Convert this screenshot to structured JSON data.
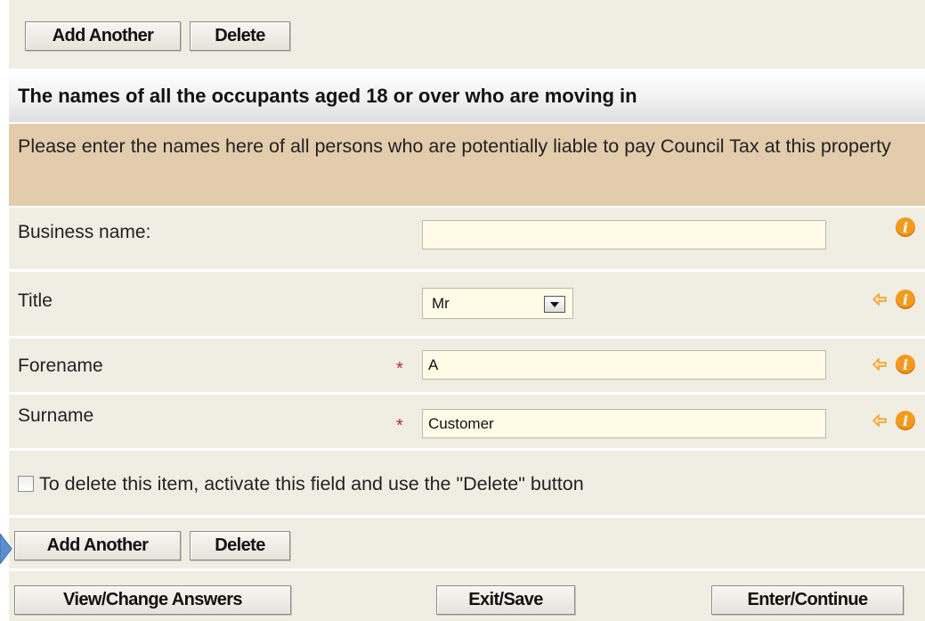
{
  "top_actions": {
    "add_another": "Add Another",
    "delete": "Delete"
  },
  "section": {
    "title": "The names of all the occupants aged 18 or over who are moving in",
    "instructions": "Please enter the names here of all persons who are potentially liable to pay Council Tax at this property"
  },
  "fields": {
    "business_name": {
      "label": "Business name:",
      "value": ""
    },
    "title": {
      "label": "Title",
      "value": "Mr"
    },
    "forename": {
      "label": "Forename",
      "value": "A",
      "required_mark": "*"
    },
    "surname": {
      "label": "Surname",
      "value": "Customer",
      "required_mark": "*"
    }
  },
  "delete_checkbox": {
    "label": "To delete this item, activate this field and use the \"Delete\" button",
    "checked": false
  },
  "bottom_actions": {
    "add_another": "Add Another",
    "delete": "Delete"
  },
  "footer": {
    "view_change": "View/Change Answers",
    "exit_save": "Exit/Save",
    "enter_continue": "Enter/Continue"
  },
  "icons": {
    "info": "info-icon",
    "back_arrow": "back-arrow-icon",
    "dropdown": "chevron-down-icon",
    "pointer": "pointer-arrow-icon"
  },
  "colors": {
    "row_background": "#f0ede3",
    "instructions_background": "#e2ccac",
    "input_background": "#fffbe6",
    "info_icon": "#f39a1e",
    "required": "#c0272d"
  }
}
